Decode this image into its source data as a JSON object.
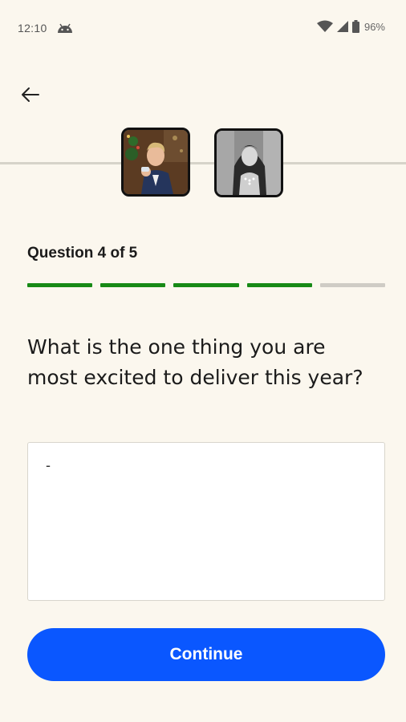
{
  "status_bar": {
    "time": "12:10",
    "battery": "96%",
    "icons": [
      "android-icon",
      "wifi-icon",
      "signal-icon",
      "battery-icon"
    ]
  },
  "header": {
    "back_icon": "arrow-left-icon"
  },
  "participants": [
    {
      "name": "avatar-man"
    },
    {
      "name": "avatar-woman"
    }
  ],
  "quiz": {
    "counter": "Question 4 of 5",
    "current": 4,
    "total": 5,
    "progress_colors": {
      "done": "#178a16",
      "pending": "#cfccc5"
    },
    "question": "What is the one thing you are most excited to deliver this year?",
    "answer_value": "-"
  },
  "actions": {
    "continue_label": "Continue",
    "accent": "#0a57ff"
  }
}
